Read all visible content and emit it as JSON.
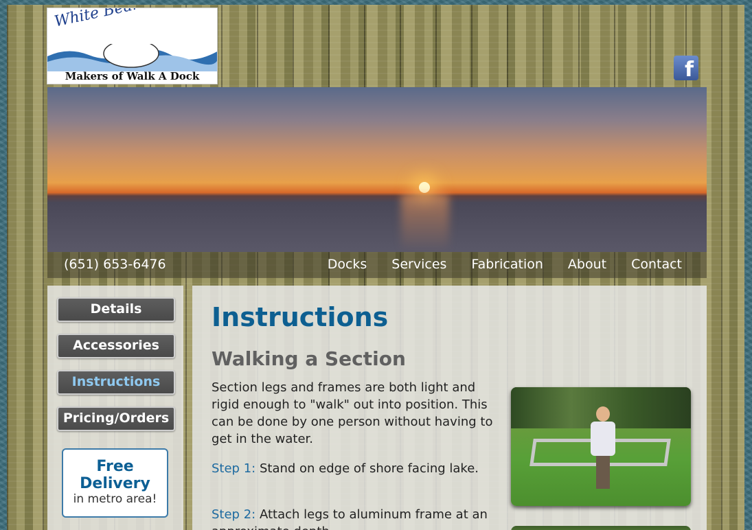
{
  "header": {
    "logo_title": "White Bear Lift & Dock",
    "logo_tagline": "Makers of Walk A Dock",
    "social_icon": "facebook-icon"
  },
  "nav": {
    "phone": "(651) 653-6476",
    "links": [
      "Docks",
      "Services",
      "Fabrication",
      "About",
      "Contact"
    ]
  },
  "sidebar": {
    "buttons": [
      "Details",
      "Accessories",
      "Instructions",
      "Pricing/Orders"
    ],
    "active": "Instructions",
    "promo_line1": "Free",
    "promo_line2": "Delivery",
    "promo_line3": "in metro area!"
  },
  "content": {
    "title": "Instructions",
    "subtitle": "Walking a Section",
    "intro": "Section legs and frames are both light and rigid enough to \"walk\" out into position. This can be done by one person without having to get in the water.",
    "step1_label": "Step 1:",
    "step1_text": "Stand on edge of shore facing lake.",
    "step2_label": "Step 2:",
    "step2_text": "Attach legs to aluminum frame at an approximate depth."
  },
  "colors": {
    "heading_blue": "#0d5f91",
    "step_blue": "#1d6aa0",
    "active_button_text": "#8fc9f0"
  }
}
